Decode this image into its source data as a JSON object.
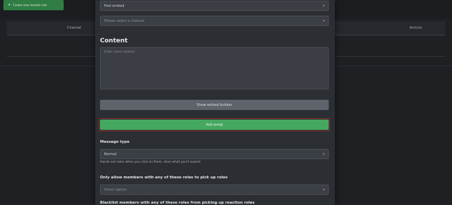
{
  "background": {
    "create_button": {
      "icon": "plus-icon",
      "label": "Create new reaction role"
    },
    "table_headers": [
      "Channel",
      "Actions"
    ]
  },
  "modal": {
    "top_fields": [
      {
        "value": "Post embed",
        "placeholder": ""
      },
      {
        "value": "",
        "placeholder": "Please select a channel"
      }
    ],
    "content_section": {
      "title": "Content",
      "placeholder": "Enter some content"
    },
    "show_emoji_builder_label": "Show embed builder",
    "add_reaction_label": "Add emoji",
    "message_type": {
      "label": "Message type",
      "value": "Normal",
      "help": "Hands out roles when you click on them, does what you'd expect"
    },
    "allow_roles": {
      "label": "Only allow members with any of these roles to pick up roles",
      "placeholder": "Select option"
    },
    "blacklist_label": "Blacklist members with any of these roles from picking up reaction roles"
  },
  "colors": {
    "accent_green": "#45a860",
    "error_red": "#8f2f2f"
  }
}
